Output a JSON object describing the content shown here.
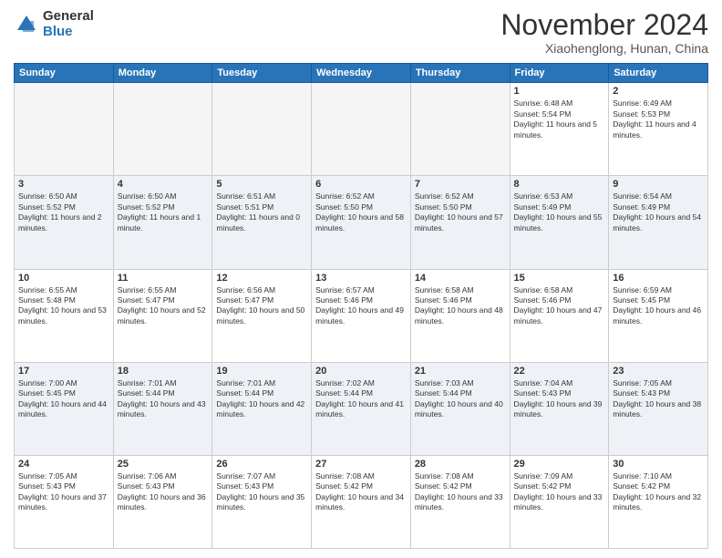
{
  "logo": {
    "general": "General",
    "blue": "Blue"
  },
  "title": "November 2024",
  "subtitle": "Xiaohenglong, Hunan, China",
  "weekdays": [
    "Sunday",
    "Monday",
    "Tuesday",
    "Wednesday",
    "Thursday",
    "Friday",
    "Saturday"
  ],
  "weeks": [
    {
      "shade": false,
      "days": [
        {
          "num": "",
          "empty": true
        },
        {
          "num": "",
          "empty": true
        },
        {
          "num": "",
          "empty": true
        },
        {
          "num": "",
          "empty": true
        },
        {
          "num": "",
          "empty": true
        },
        {
          "num": "1",
          "sunrise": "Sunrise: 6:48 AM",
          "sunset": "Sunset: 5:54 PM",
          "daylight": "Daylight: 11 hours and 5 minutes."
        },
        {
          "num": "2",
          "sunrise": "Sunrise: 6:49 AM",
          "sunset": "Sunset: 5:53 PM",
          "daylight": "Daylight: 11 hours and 4 minutes."
        }
      ]
    },
    {
      "shade": true,
      "days": [
        {
          "num": "3",
          "sunrise": "Sunrise: 6:50 AM",
          "sunset": "Sunset: 5:52 PM",
          "daylight": "Daylight: 11 hours and 2 minutes."
        },
        {
          "num": "4",
          "sunrise": "Sunrise: 6:50 AM",
          "sunset": "Sunset: 5:52 PM",
          "daylight": "Daylight: 11 hours and 1 minute."
        },
        {
          "num": "5",
          "sunrise": "Sunrise: 6:51 AM",
          "sunset": "Sunset: 5:51 PM",
          "daylight": "Daylight: 11 hours and 0 minutes."
        },
        {
          "num": "6",
          "sunrise": "Sunrise: 6:52 AM",
          "sunset": "Sunset: 5:50 PM",
          "daylight": "Daylight: 10 hours and 58 minutes."
        },
        {
          "num": "7",
          "sunrise": "Sunrise: 6:52 AM",
          "sunset": "Sunset: 5:50 PM",
          "daylight": "Daylight: 10 hours and 57 minutes."
        },
        {
          "num": "8",
          "sunrise": "Sunrise: 6:53 AM",
          "sunset": "Sunset: 5:49 PM",
          "daylight": "Daylight: 10 hours and 55 minutes."
        },
        {
          "num": "9",
          "sunrise": "Sunrise: 6:54 AM",
          "sunset": "Sunset: 5:49 PM",
          "daylight": "Daylight: 10 hours and 54 minutes."
        }
      ]
    },
    {
      "shade": false,
      "days": [
        {
          "num": "10",
          "sunrise": "Sunrise: 6:55 AM",
          "sunset": "Sunset: 5:48 PM",
          "daylight": "Daylight: 10 hours and 53 minutes."
        },
        {
          "num": "11",
          "sunrise": "Sunrise: 6:55 AM",
          "sunset": "Sunset: 5:47 PM",
          "daylight": "Daylight: 10 hours and 52 minutes."
        },
        {
          "num": "12",
          "sunrise": "Sunrise: 6:56 AM",
          "sunset": "Sunset: 5:47 PM",
          "daylight": "Daylight: 10 hours and 50 minutes."
        },
        {
          "num": "13",
          "sunrise": "Sunrise: 6:57 AM",
          "sunset": "Sunset: 5:46 PM",
          "daylight": "Daylight: 10 hours and 49 minutes."
        },
        {
          "num": "14",
          "sunrise": "Sunrise: 6:58 AM",
          "sunset": "Sunset: 5:46 PM",
          "daylight": "Daylight: 10 hours and 48 minutes."
        },
        {
          "num": "15",
          "sunrise": "Sunrise: 6:58 AM",
          "sunset": "Sunset: 5:46 PM",
          "daylight": "Daylight: 10 hours and 47 minutes."
        },
        {
          "num": "16",
          "sunrise": "Sunrise: 6:59 AM",
          "sunset": "Sunset: 5:45 PM",
          "daylight": "Daylight: 10 hours and 46 minutes."
        }
      ]
    },
    {
      "shade": true,
      "days": [
        {
          "num": "17",
          "sunrise": "Sunrise: 7:00 AM",
          "sunset": "Sunset: 5:45 PM",
          "daylight": "Daylight: 10 hours and 44 minutes."
        },
        {
          "num": "18",
          "sunrise": "Sunrise: 7:01 AM",
          "sunset": "Sunset: 5:44 PM",
          "daylight": "Daylight: 10 hours and 43 minutes."
        },
        {
          "num": "19",
          "sunrise": "Sunrise: 7:01 AM",
          "sunset": "Sunset: 5:44 PM",
          "daylight": "Daylight: 10 hours and 42 minutes."
        },
        {
          "num": "20",
          "sunrise": "Sunrise: 7:02 AM",
          "sunset": "Sunset: 5:44 PM",
          "daylight": "Daylight: 10 hours and 41 minutes."
        },
        {
          "num": "21",
          "sunrise": "Sunrise: 7:03 AM",
          "sunset": "Sunset: 5:44 PM",
          "daylight": "Daylight: 10 hours and 40 minutes."
        },
        {
          "num": "22",
          "sunrise": "Sunrise: 7:04 AM",
          "sunset": "Sunset: 5:43 PM",
          "daylight": "Daylight: 10 hours and 39 minutes."
        },
        {
          "num": "23",
          "sunrise": "Sunrise: 7:05 AM",
          "sunset": "Sunset: 5:43 PM",
          "daylight": "Daylight: 10 hours and 38 minutes."
        }
      ]
    },
    {
      "shade": false,
      "days": [
        {
          "num": "24",
          "sunrise": "Sunrise: 7:05 AM",
          "sunset": "Sunset: 5:43 PM",
          "daylight": "Daylight: 10 hours and 37 minutes."
        },
        {
          "num": "25",
          "sunrise": "Sunrise: 7:06 AM",
          "sunset": "Sunset: 5:43 PM",
          "daylight": "Daylight: 10 hours and 36 minutes."
        },
        {
          "num": "26",
          "sunrise": "Sunrise: 7:07 AM",
          "sunset": "Sunset: 5:43 PM",
          "daylight": "Daylight: 10 hours and 35 minutes."
        },
        {
          "num": "27",
          "sunrise": "Sunrise: 7:08 AM",
          "sunset": "Sunset: 5:42 PM",
          "daylight": "Daylight: 10 hours and 34 minutes."
        },
        {
          "num": "28",
          "sunrise": "Sunrise: 7:08 AM",
          "sunset": "Sunset: 5:42 PM",
          "daylight": "Daylight: 10 hours and 33 minutes."
        },
        {
          "num": "29",
          "sunrise": "Sunrise: 7:09 AM",
          "sunset": "Sunset: 5:42 PM",
          "daylight": "Daylight: 10 hours and 33 minutes."
        },
        {
          "num": "30",
          "sunrise": "Sunrise: 7:10 AM",
          "sunset": "Sunset: 5:42 PM",
          "daylight": "Daylight: 10 hours and 32 minutes."
        }
      ]
    }
  ]
}
